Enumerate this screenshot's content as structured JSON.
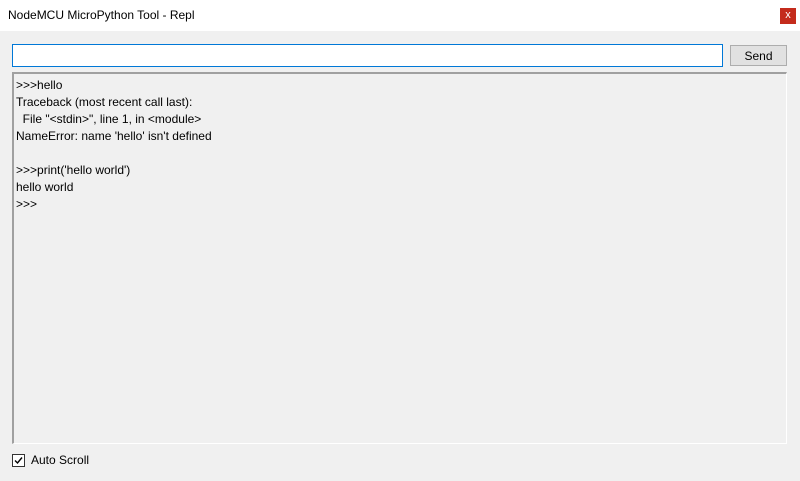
{
  "window": {
    "title": "NodeMCU MicroPython Tool - Repl",
    "close_label": "x"
  },
  "command": {
    "value": "",
    "send_label": "Send"
  },
  "output": {
    "lines": [
      ">>>hello",
      "Traceback (most recent call last):",
      "  File \"<stdin>\", line 1, in <module>",
      "NameError: name 'hello' isn't defined",
      "",
      ">>>print('hello world')",
      "hello world",
      ">>>"
    ]
  },
  "auto_scroll": {
    "label": "Auto Scroll",
    "checked": true
  },
  "colors": {
    "close_button": "#c42b1c",
    "input_focus_border": "#0078d7"
  }
}
